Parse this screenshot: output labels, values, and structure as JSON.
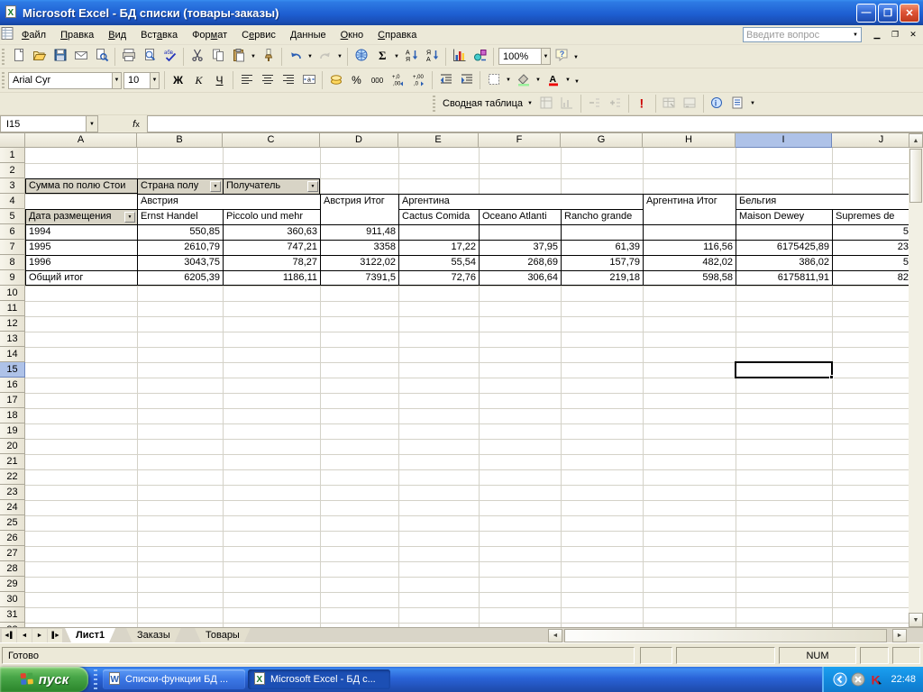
{
  "title_bar": {
    "title": "Microsoft Excel - БД списки (товары-заказы)"
  },
  "menu_bar": {
    "items": [
      "Файл",
      "Правка",
      "Вид",
      "Вставка",
      "Формат",
      "Сервис",
      "Данные",
      "Окно",
      "Справка"
    ],
    "question_box_placeholder": "Введите вопрос"
  },
  "standard_toolbar": {
    "zoom_value": "100%",
    "buttons": [
      "new",
      "open",
      "save",
      "mail",
      "search",
      "sep",
      "print",
      "print-preview",
      "spelling",
      "sep",
      "cut",
      "copy",
      "paste-dd",
      "format-painter",
      "sep",
      "undo-dd",
      "redo-dd",
      "sep",
      "hyperlink",
      "autosum-dd",
      "sort-ascending",
      "sort-descending",
      "sep",
      "chart-wizard",
      "drawing",
      "sep",
      "zoom-combo",
      "help",
      "toolbar-options"
    ]
  },
  "formatting_toolbar": {
    "font_name": "Arial Cyr",
    "font_size": "10",
    "bold_label": "Ж",
    "italic_label": "К",
    "underline_label": "Ч",
    "percent_label": "%",
    "thousands_label": "000",
    "buttons": [
      "font-combo",
      "size-combo",
      "sep",
      "bold",
      "italic",
      "underline",
      "sep",
      "align-left",
      "align-center",
      "align-right",
      "merge-center",
      "sep",
      "currency",
      "percent",
      "thousands",
      "inc-decimal",
      "dec-decimal",
      "sep",
      "dec-indent",
      "inc-indent",
      "sep",
      "borders-dd",
      "fill-color-dd",
      "font-color-dd",
      "toolbar-options"
    ]
  },
  "pivot_toolbar": {
    "label": "Сводная таблица",
    "buttons": [
      "format-report",
      "chart-wizard2",
      "sep",
      "hide-detail",
      "show-detail",
      "sep",
      "refresh",
      "sep",
      "include-hidden",
      "always-total",
      "sep",
      "field-settings",
      "field-list",
      "toolbar-options"
    ]
  },
  "formula_bar": {
    "name_box": "I15",
    "fx_label": "fx",
    "value": ""
  },
  "grid": {
    "columns": [
      "A",
      "B",
      "C",
      "D",
      "E",
      "F",
      "G",
      "H",
      "I",
      "J"
    ],
    "row_count": 32,
    "selected_column": "I",
    "selected_row": 15,
    "selected_cell": "I15"
  },
  "pivot_table": {
    "value_field": "Сумма по полю Стои",
    "column_field": "Страна полу",
    "column_field2": "Получатель",
    "row_field": "Дата размещения",
    "header_cells": [
      {
        "label": "Австрия",
        "col_start": "B",
        "col_end": "C",
        "row": 4,
        "row_span": 1
      },
      {
        "label": "Австрия Итог",
        "col_start": "D",
        "col_end": "D",
        "row": 4,
        "row_span": 2
      },
      {
        "label": "Аргентина",
        "col_start": "E",
        "col_end": "G",
        "row": 4,
        "row_span": 1
      },
      {
        "label": "Аргентина Итог",
        "col_start": "H",
        "col_end": "H",
        "row": 4,
        "row_span": 2
      },
      {
        "label": "Бельгия",
        "col_start": "I",
        "col_end": "J",
        "row": 4,
        "row_span": 1
      },
      {
        "label": "Ernst Handel",
        "col_start": "B",
        "col_end": "B",
        "row": 5,
        "row_span": 1
      },
      {
        "label": "Piccolo und mehr",
        "col_start": "C",
        "col_end": "C",
        "row": 5,
        "row_span": 1
      },
      {
        "label": "Cactus Comida",
        "col_start": "E",
        "col_end": "E",
        "row": 5,
        "row_span": 1
      },
      {
        "label": "Oceano Atlanti",
        "col_start": "F",
        "col_end": "F",
        "row": 5,
        "row_span": 1
      },
      {
        "label": "Rancho grande",
        "col_start": "G",
        "col_end": "G",
        "row": 5,
        "row_span": 1
      },
      {
        "label": "Maison Dewey",
        "col_start": "I",
        "col_end": "I",
        "row": 5,
        "row_span": 1
      },
      {
        "label": "Supremes de",
        "col_start": "J",
        "col_end": "J",
        "row": 5,
        "row_span": 1
      }
    ],
    "data_rows": [
      {
        "label": "1994",
        "row": 6,
        "values": {
          "B": "550,85",
          "C": "360,63",
          "D": "911,48",
          "E": "",
          "F": "",
          "G": "",
          "H": "",
          "I": "",
          "J": "5"
        }
      },
      {
        "label": "1995",
        "row": 7,
        "values": {
          "B": "2610,79",
          "C": "747,21",
          "D": "3358",
          "E": "17,22",
          "F": "37,95",
          "G": "61,39",
          "H": "116,56",
          "I": "6175425,89",
          "J": "23"
        }
      },
      {
        "label": "1996",
        "row": 8,
        "values": {
          "B": "3043,75",
          "C": "78,27",
          "D": "3122,02",
          "E": "55,54",
          "F": "268,69",
          "G": "157,79",
          "H": "482,02",
          "I": "386,02",
          "J": "5"
        }
      },
      {
        "label": "Общий итог",
        "row": 9,
        "values": {
          "B": "6205,39",
          "C": "1186,11",
          "D": "7391,5",
          "E": "72,76",
          "F": "306,64",
          "G": "219,18",
          "H": "598,58",
          "I": "6175811,91",
          "J": "82"
        }
      }
    ]
  },
  "sheet_tabs": {
    "tabs": [
      "Лист1",
      "Заказы",
      "Товары"
    ],
    "active": "Лист1"
  },
  "status_bar": {
    "ready": "Готово",
    "num": "NUM"
  },
  "taskbar": {
    "start_label": "пуск",
    "buttons": [
      {
        "icon": "word",
        "label": "Списки-функции БД ...",
        "active": false
      },
      {
        "icon": "excel",
        "label": "Microsoft Excel - БД с...",
        "active": true
      }
    ],
    "tray_icons": [
      "collapse-chevron",
      "messenger",
      "kaspersky"
    ],
    "clock": "22:48"
  }
}
